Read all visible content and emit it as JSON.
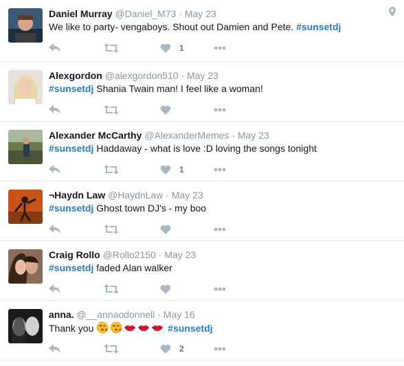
{
  "tweets": [
    {
      "name": "Daniel Murray",
      "handle": "@Daniel_M73",
      "separator": "·",
      "time": "May 23",
      "text_before": "We like to party- vengaboys. Shout out Damien and Pete. ",
      "hashtag": "#sunsetdj",
      "text_after": "",
      "like_count": "1",
      "has_location": true
    },
    {
      "name": "Alexgordon",
      "handle": "@alexgordon510",
      "separator": "·",
      "time": "May 23",
      "text_before": "",
      "hashtag": "#sunsetdj",
      "text_after": " Shania Twain man! I feel like a woman!",
      "like_count": ""
    },
    {
      "name": "Alexander McCarthy",
      "handle": "@AlexanderMemes",
      "separator": "·",
      "time": "May 23",
      "text_before": "",
      "hashtag": "#sunsetdj",
      "text_after": " Haddaway - what is love :D loving the songs tonight",
      "like_count": "1"
    },
    {
      "name": "¬Haydn Law",
      "handle": "@HaydnLaw",
      "separator": "·",
      "time": "May 23",
      "text_before": "",
      "hashtag": "#sunsetdj",
      "text_after": " Ghost town DJ's - my boo",
      "like_count": ""
    },
    {
      "name": "Craig Rollo",
      "handle": "@Rollo2150",
      "separator": "·",
      "time": "May 23",
      "text_before": "",
      "hashtag": "#sunsetdj",
      "text_after": " faded Alan walker",
      "like_count": ""
    },
    {
      "name": "anna.",
      "handle": "@__annaodonnell",
      "separator": "·",
      "time": "May 16",
      "text_before": "Thank you ",
      "emojis": [
        "kissing-face-emoji",
        "kissing-face-emoji",
        "lips-emoji",
        "lips-emoji",
        "lips-emoji"
      ],
      "hashtag": "#sunsetdj",
      "text_after": "",
      "like_count": "2"
    }
  ],
  "icons": {
    "reply": "reply-icon",
    "retweet": "retweet-icon",
    "like": "heart-icon",
    "more": "more-dots-icon",
    "location": "location-pin-icon"
  },
  "colors": {
    "name": "#14171a",
    "meta": "#8899a6",
    "hashtag": "#2b7bb9",
    "action_icon": "#aab8c2",
    "divider": "#e1e8ed"
  }
}
